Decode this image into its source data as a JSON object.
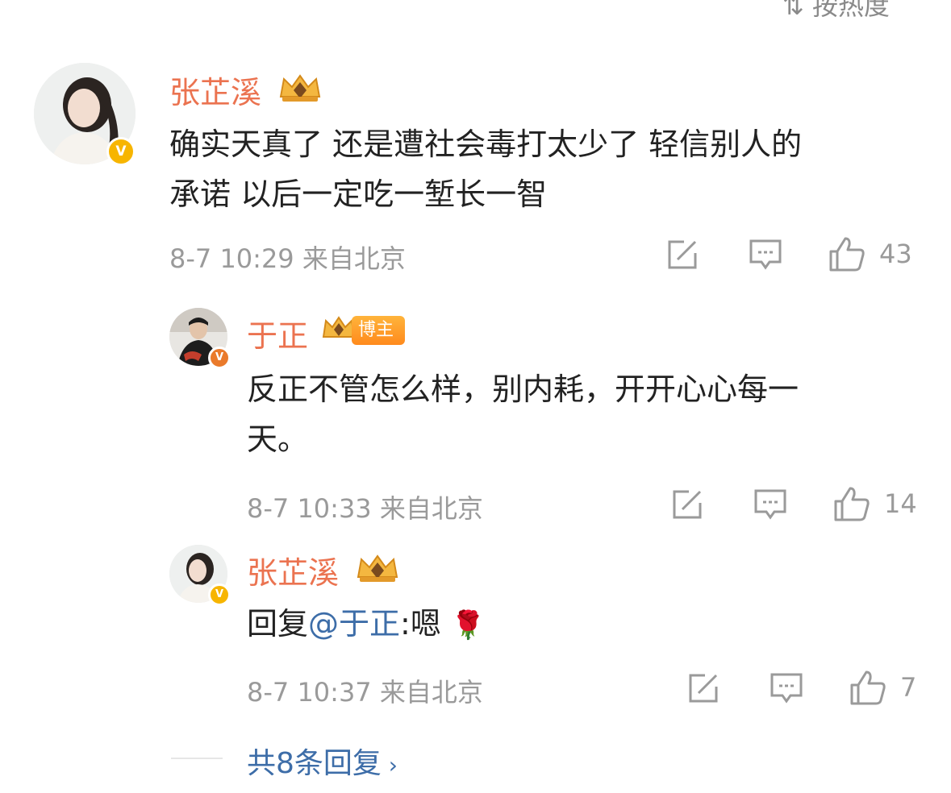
{
  "header": {
    "sort_label": "按热度"
  },
  "comment": {
    "username": "张芷溪",
    "text_line1": "确实天真了 还是遭社会毒打太少了 轻信别人的",
    "text_line2": "承诺 以后一定吃一堑长一智",
    "time": "8-7 10:29",
    "location": "来自北京",
    "likes": "43",
    "verified": "V"
  },
  "replies": [
    {
      "username": "于正",
      "role_badge": "博主",
      "text_line1": "反正不管怎么样，别内耗，开开心心每一",
      "text_line2": "天。",
      "time": "8-7 10:33",
      "location": "来自北京",
      "likes": "14",
      "verified": "V"
    },
    {
      "username": "张芷溪",
      "reply_prefix": "回复",
      "mention": "@于正",
      "reply_text": ":嗯",
      "emoji": "🌹",
      "time": "8-7 10:37",
      "location": "来自北京",
      "likes": "7",
      "verified": "V"
    }
  ],
  "footer": {
    "more_replies": "共8条回复"
  },
  "colors": {
    "username": "#eb7350",
    "link": "#3d6da8",
    "meta": "#9a9a9a",
    "badge": "#f7b500"
  },
  "icons": [
    "repost-icon",
    "comment-icon",
    "like-icon",
    "crown-icon",
    "verified-icon",
    "chevron-right-icon"
  ]
}
